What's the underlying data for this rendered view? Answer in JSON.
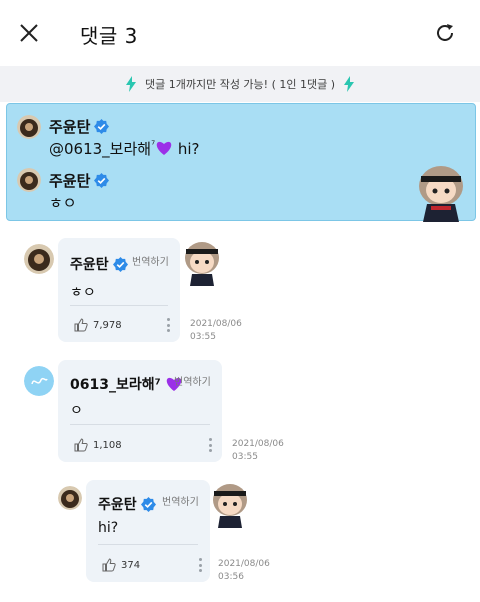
{
  "header": {
    "title": "댓글 3",
    "close_icon": "close-icon",
    "refresh_icon": "refresh-icon"
  },
  "notice": {
    "text": "댓글 1개까지만 작성 가능! ( 1인 1댓글 )",
    "icon": "lightning-icon",
    "icon_color": "#2ac6b0"
  },
  "pinned": {
    "background": "#a9def4",
    "rows": [
      {
        "author": "주윤탄",
        "mention": "@0613_보라해",
        "superscript": "⁷",
        "message": " hi?"
      },
      {
        "author": "주윤탄",
        "message": "ㅎㅇ"
      }
    ]
  },
  "comments": [
    {
      "author": "주윤탄",
      "translate": "번역하기",
      "text": "ㅎㅇ",
      "likes": "7,978",
      "date": "2021/08/06",
      "time": "03:55"
    },
    {
      "author": "0613_보라해⁷",
      "translate": "번역하기",
      "text": "ㅇ",
      "likes": "1,108",
      "date": "2021/08/06",
      "time": "03:55"
    },
    {
      "author": "주윤탄",
      "translate": "번역하기",
      "text": "hi?",
      "likes": "374",
      "date": "2021/08/06",
      "time": "03:56"
    }
  ],
  "colors": {
    "verified": "#2e8be8",
    "heart": "#9b30e8",
    "card": "#eef3f8"
  }
}
